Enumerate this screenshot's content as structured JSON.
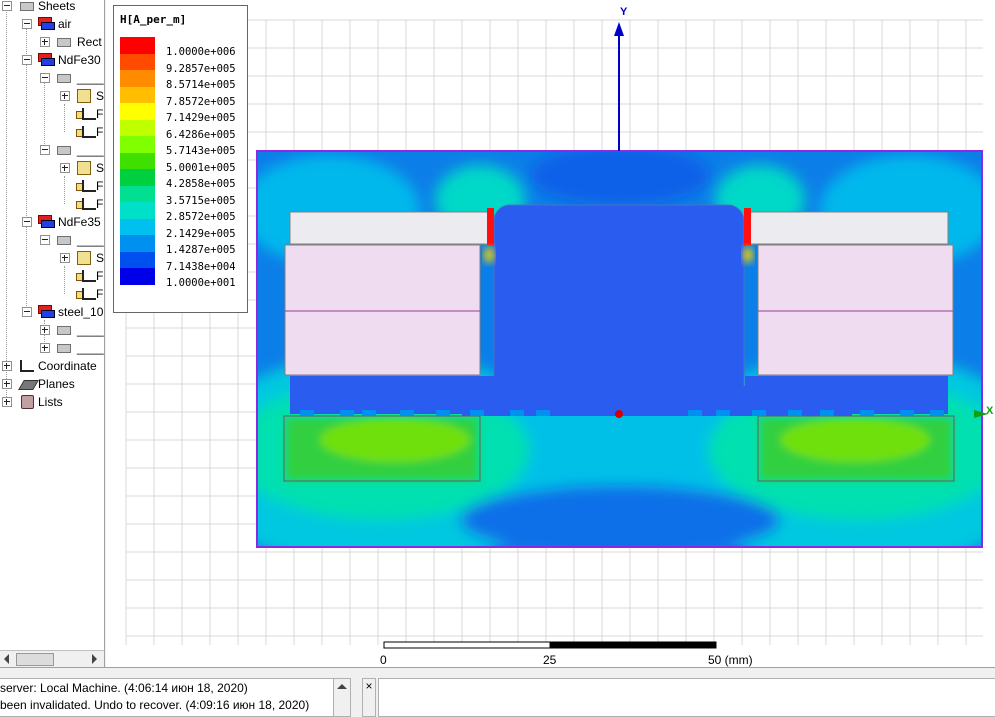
{
  "tree": {
    "items": [
      {
        "label": "Sheets",
        "icon": "sheet-icon"
      },
      {
        "label": "air",
        "icon": "material-icon"
      },
      {
        "label": "Rect",
        "icon": "sheet-icon"
      },
      {
        "label": "NdFe30",
        "icon": "material-icon"
      },
      {
        "label": "____",
        "icon": "sheet-icon"
      },
      {
        "label": "S",
        "icon": "cube-icon"
      },
      {
        "label": "F",
        "icon": "edit-icon"
      },
      {
        "label": "F",
        "icon": "edit-icon"
      },
      {
        "label": "____",
        "icon": "sheet-icon"
      },
      {
        "label": "S",
        "icon": "cube-icon"
      },
      {
        "label": "F",
        "icon": "edit-icon"
      },
      {
        "label": "F",
        "icon": "edit-icon"
      },
      {
        "label": "NdFe35",
        "icon": "material-icon"
      },
      {
        "label": "____",
        "icon": "sheet-icon"
      },
      {
        "label": "S",
        "icon": "cube-icon"
      },
      {
        "label": "F",
        "icon": "edit-icon"
      },
      {
        "label": "F",
        "icon": "edit-icon"
      },
      {
        "label": "steel_10",
        "icon": "material-icon"
      },
      {
        "label": "____",
        "icon": "sheet-icon"
      },
      {
        "label": "____",
        "icon": "sheet-icon"
      },
      {
        "label": "Coordinate",
        "icon": "coordinate-icon"
      },
      {
        "label": "Planes",
        "icon": "planes-icon"
      },
      {
        "label": "Lists",
        "icon": "lists-icon"
      }
    ]
  },
  "legend": {
    "title": "H[A_per_m]",
    "values": [
      "1.0000e+006",
      "9.2857e+005",
      "8.5714e+005",
      "7.8572e+005",
      "7.1429e+005",
      "6.4286e+005",
      "5.7143e+005",
      "5.0001e+005",
      "4.2858e+005",
      "3.5715e+005",
      "2.8572e+005",
      "2.1429e+005",
      "1.4287e+005",
      "7.1438e+004",
      "1.0000e+001"
    ],
    "colors": [
      "#ff0000",
      "#ff4a00",
      "#ff8c00",
      "#ffbf00",
      "#ffff00",
      "#bfff00",
      "#7fff00",
      "#3fe000",
      "#00d040",
      "#00e090",
      "#00e0c8",
      "#00c0f0",
      "#0090f0",
      "#0050f0",
      "#0000e8"
    ]
  },
  "axes": {
    "y_label": "Y",
    "x_label": "X"
  },
  "scale": {
    "ticks": [
      "0",
      "25",
      "50 (mm)"
    ]
  },
  "messages": [
    "server: Local Machine. (4:06:14 июн 18, 2020)",
    "been invalidated. Undo to recover. (4:09:16 июн 18, 2020)"
  ],
  "close_label": "×",
  "colors": {
    "field_background": "#1a66e8",
    "steel": "#2b5cf0",
    "boundary": "#8a2be2",
    "magnet_fill": "#f0dcf0",
    "grid": "#d8d8d8"
  }
}
